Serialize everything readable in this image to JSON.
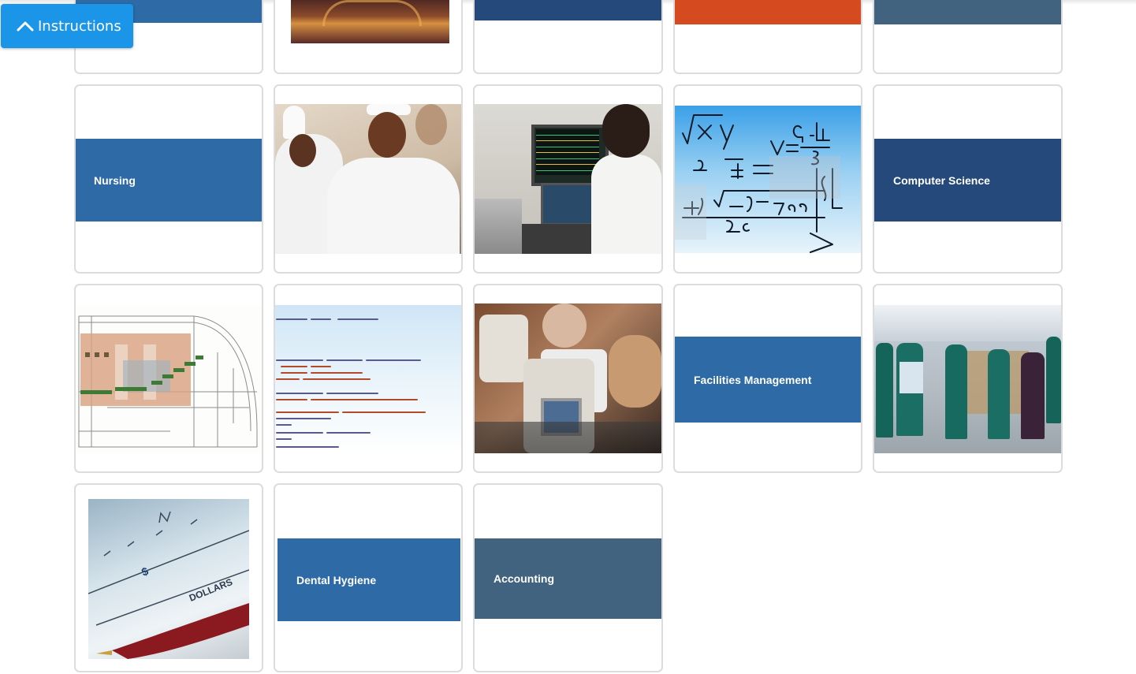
{
  "instructions_button": {
    "label": "Instructions",
    "icon": "chevron-up-icon"
  },
  "colors": {
    "button": "#1a95e8",
    "blue": "#2e6aa6",
    "dark_blue": "#24497a",
    "slate": "#41637f",
    "orange": "#d64a20"
  },
  "tiles": [
    {
      "name": "tile-top-1",
      "label": ""
    },
    {
      "name": "tile-top-2",
      "label": ""
    },
    {
      "name": "tile-top-3",
      "label": ""
    },
    {
      "name": "tile-top-4",
      "label": ""
    },
    {
      "name": "tile-top-5",
      "label": ""
    },
    {
      "name": "tile-nursing",
      "label": "Nursing"
    },
    {
      "name": "tile-culinary",
      "label": ""
    },
    {
      "name": "tile-patient-monitor",
      "label": ""
    },
    {
      "name": "tile-math",
      "label": ""
    },
    {
      "name": "tile-computer-science",
      "label": "Computer Science"
    },
    {
      "name": "tile-architecture",
      "label": ""
    },
    {
      "name": "tile-code",
      "label": ""
    },
    {
      "name": "tile-optometry",
      "label": ""
    },
    {
      "name": "tile-facilities-management",
      "label": "Facilities Management"
    },
    {
      "name": "tile-medical-staff",
      "label": ""
    },
    {
      "name": "tile-check",
      "label": ""
    },
    {
      "name": "tile-dental-hygiene",
      "label": "Dental Hygiene"
    },
    {
      "name": "tile-accounting",
      "label": "Accounting"
    }
  ]
}
